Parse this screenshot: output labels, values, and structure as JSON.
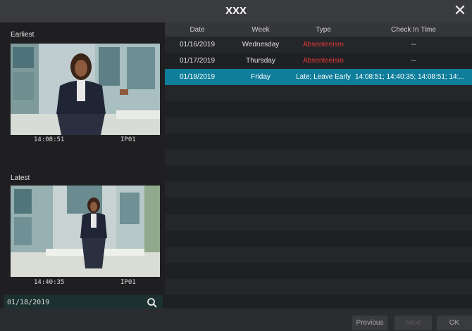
{
  "window": {
    "title": "XXX"
  },
  "earliest": {
    "label": "Earliest",
    "time": "14:08:51",
    "channel": "IP01"
  },
  "latest": {
    "label": "Latest",
    "time": "14:40:35",
    "channel": "IP01"
  },
  "search": {
    "date": "01/18/2019"
  },
  "table": {
    "headers": [
      "Date",
      "Week",
      "Type",
      "Check In Time"
    ],
    "rows": [
      {
        "date": "01/16/2019",
        "week": "Wednesday",
        "type": "Absenteeism",
        "checkin": "--"
      },
      {
        "date": "01/17/2019",
        "week": "Thursday",
        "type": "Absenteeism",
        "checkin": "--"
      },
      {
        "date": "01/18/2019",
        "week": "Friday",
        "type": "Late; Leave Early",
        "checkin": "14:08:51; 14:40:35; 14:08:51; 14:..."
      }
    ]
  },
  "footer": {
    "previous": "Previous",
    "next": "Next",
    "ok": "OK"
  },
  "colors": {
    "selected_row": "#0f7e9b",
    "absenteeism": "#e33a3a"
  }
}
